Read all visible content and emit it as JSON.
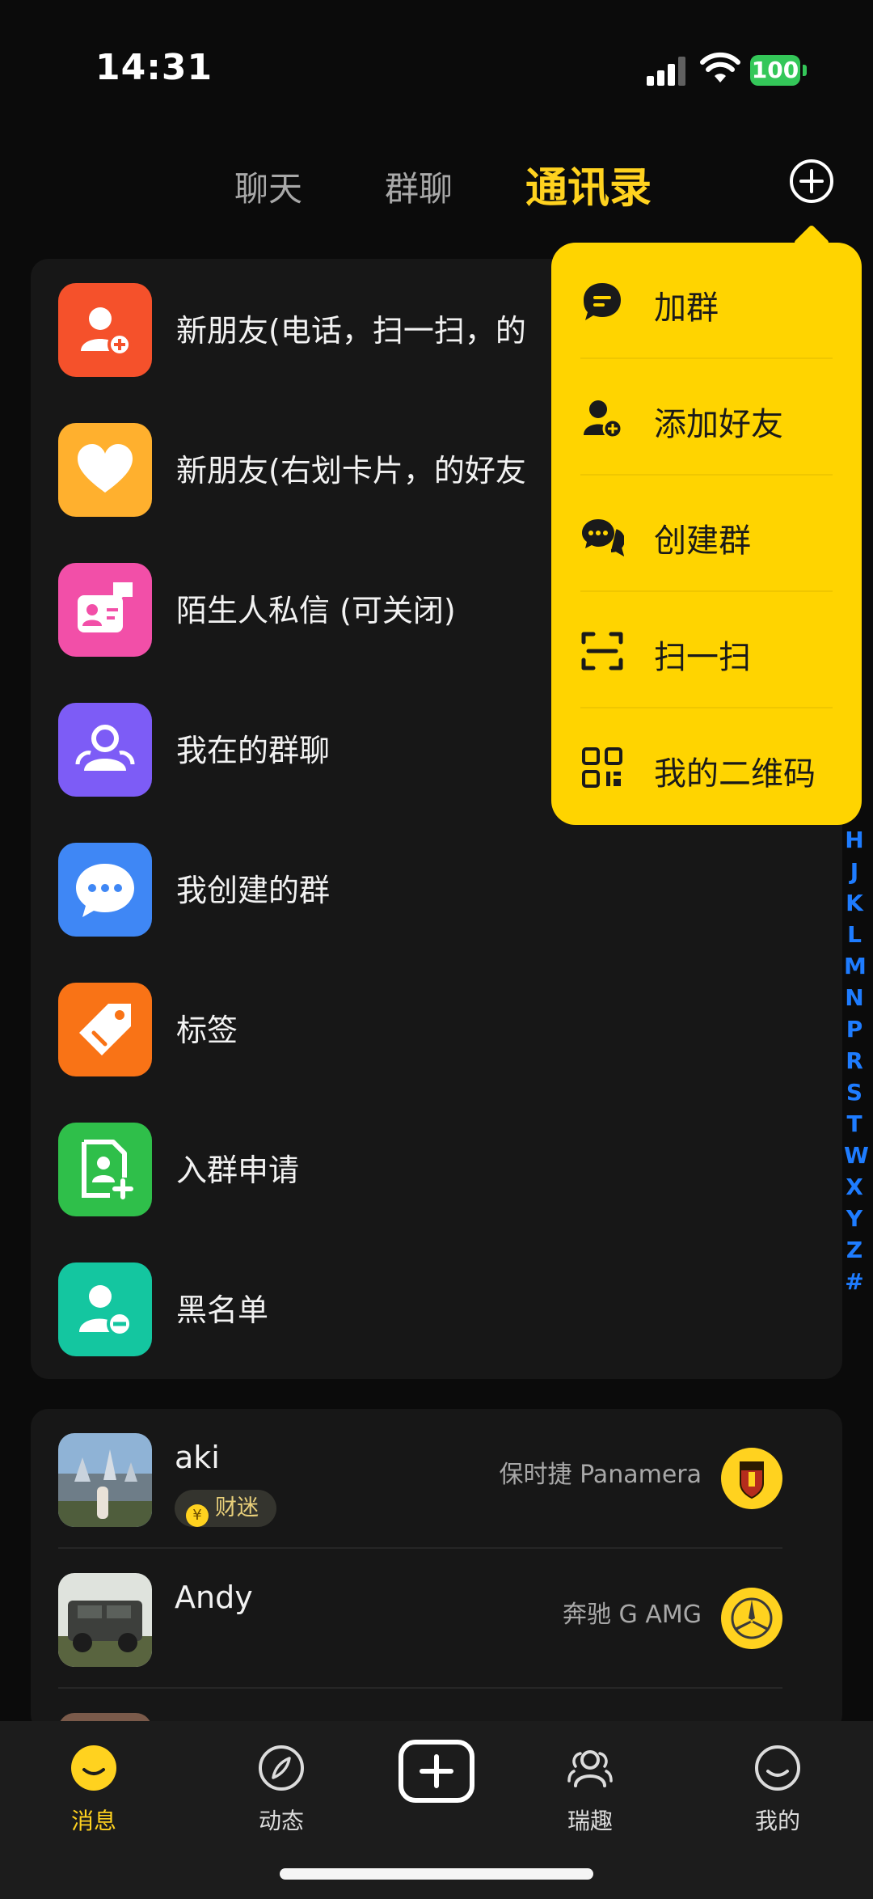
{
  "status_bar": {
    "time": "14:31",
    "battery": "100"
  },
  "top_tabs": [
    {
      "label": "聊天"
    },
    {
      "label": "群聊"
    },
    {
      "label": "通讯录"
    }
  ],
  "menu_rows": [
    {
      "label": "新朋友(电话，扫一扫，的",
      "icon": "add-user-icon",
      "color": "#f5512b"
    },
    {
      "label": "新朋友(右划卡片，的好友",
      "icon": "heart-icon",
      "color": "#ffb02e"
    },
    {
      "label": "陌生人私信 (可关闭)",
      "icon": "stranger-message-icon",
      "color": "#f24fa8"
    },
    {
      "label": "我在的群聊",
      "icon": "group-icon",
      "color": "#7d5cf6"
    },
    {
      "label": "我创建的群",
      "icon": "chat-bubble-icon",
      "color": "#3f87f5"
    },
    {
      "label": "标签",
      "icon": "tag-icon",
      "color": "#f97316"
    },
    {
      "label": "入群申请",
      "icon": "group-request-icon",
      "color": "#2fbf4a"
    },
    {
      "label": "黑名单",
      "icon": "blocklist-icon",
      "color": "#14c6a0"
    }
  ],
  "friends": [
    {
      "name": "aki",
      "badge": "财迷",
      "car": "保时捷 Panamera",
      "car_logo": "porsche-logo-icon"
    },
    {
      "name": "Andy",
      "badge": "",
      "car": "奔驰 G AMG",
      "car_logo": "mercedes-logo-icon"
    }
  ],
  "index_letters": [
    "H",
    "J",
    "K",
    "L",
    "M",
    "N",
    "P",
    "R",
    "S",
    "T",
    "W",
    "X",
    "Y",
    "Z",
    "#"
  ],
  "popup_menu": [
    {
      "label": "加群",
      "icon": "join-group-icon"
    },
    {
      "label": "添加好友",
      "icon": "add-friend-icon"
    },
    {
      "label": "创建群",
      "icon": "create-group-icon"
    },
    {
      "label": "扫一扫",
      "icon": "scan-icon"
    },
    {
      "label": "我的二维码",
      "icon": "qr-code-icon"
    }
  ],
  "bottom_nav": [
    {
      "label": "消息",
      "icon": "messages-icon",
      "active": true
    },
    {
      "label": "动态",
      "icon": "compass-icon",
      "active": false
    },
    {
      "label": "瑞趣",
      "icon": "people-icon",
      "active": false
    },
    {
      "label": "我的",
      "icon": "smiley-icon",
      "active": false
    }
  ],
  "colors": {
    "accent": "#ffd21f",
    "popup": "#ffd400",
    "index": "#1e7cff"
  }
}
